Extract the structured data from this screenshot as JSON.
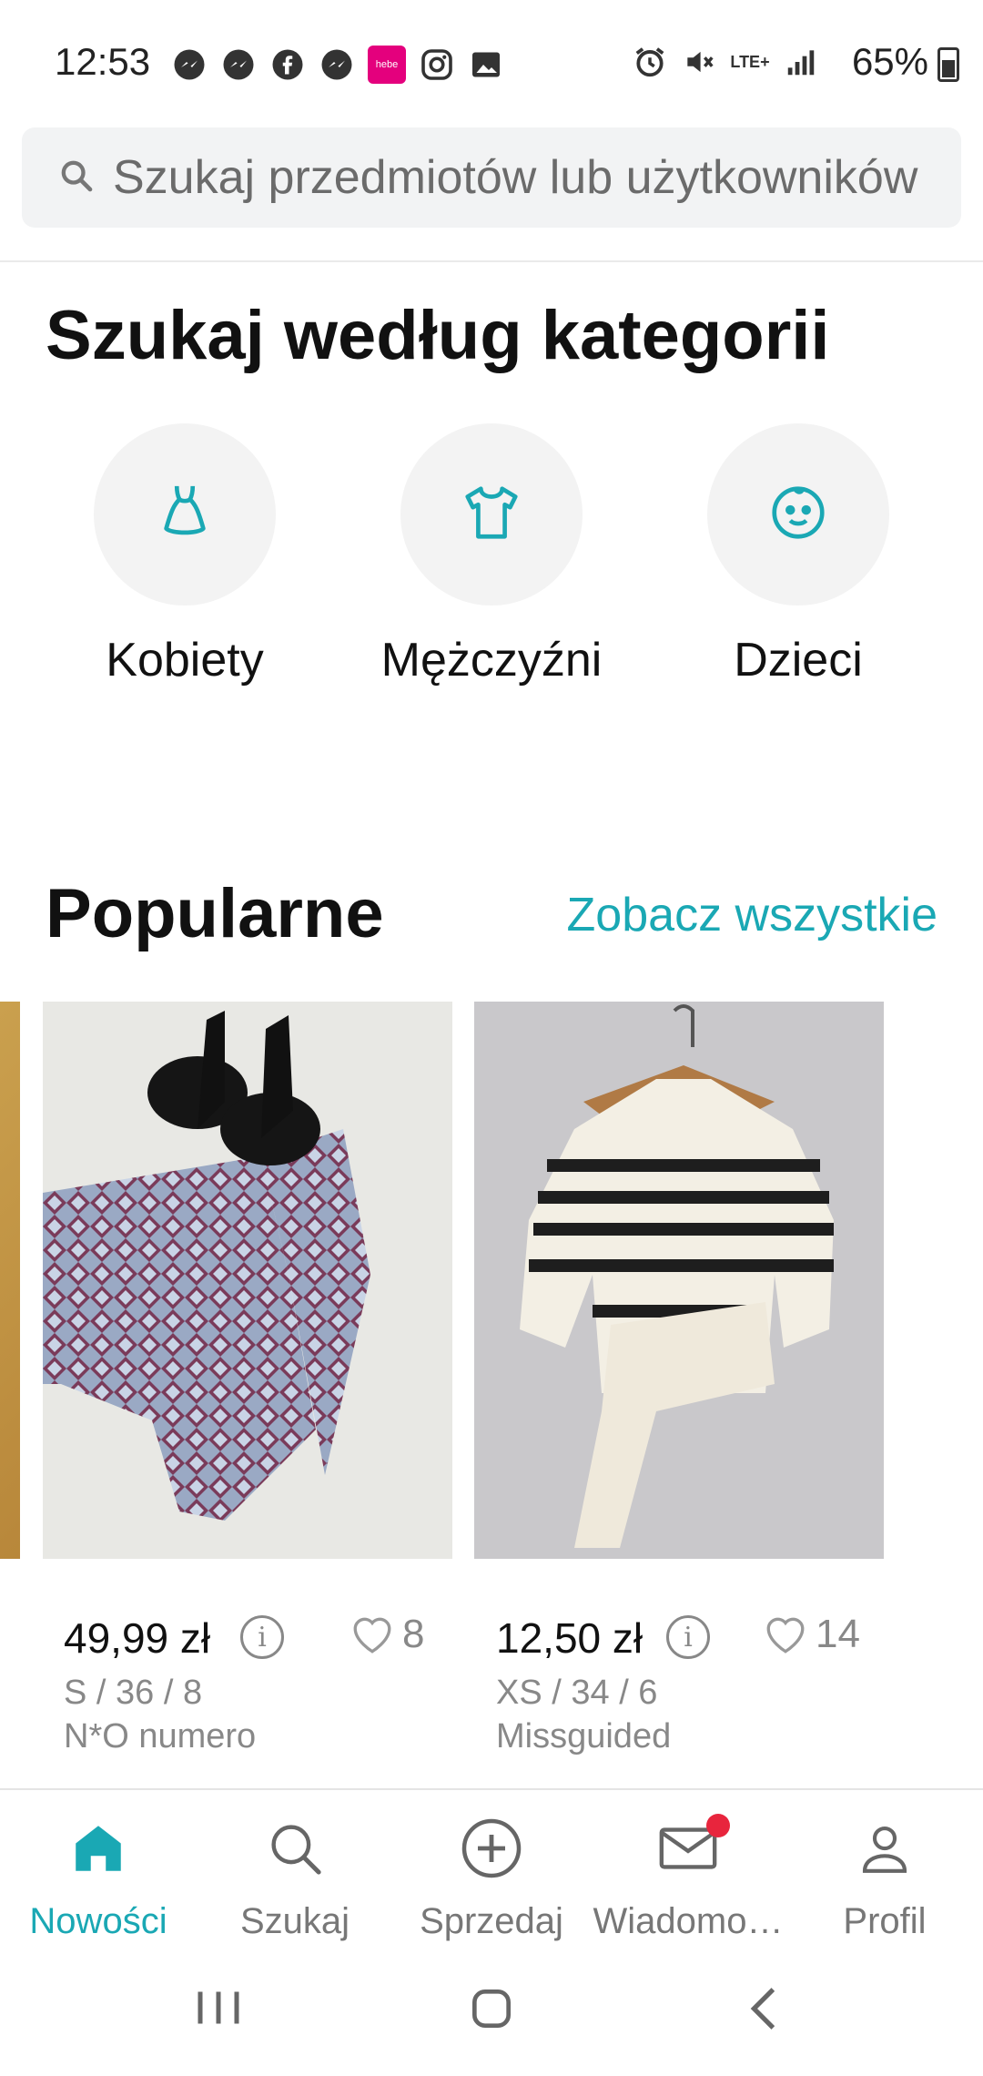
{
  "status_bar": {
    "time": "12:53",
    "battery": "65%",
    "network": "LTE+"
  },
  "search": {
    "placeholder": "Szukaj przedmiotów lub użytkowników"
  },
  "categories": {
    "title": "Szukaj według kategorii",
    "items": [
      {
        "label": "Kobiety",
        "icon": "dress-icon"
      },
      {
        "label": "Mężczyźni",
        "icon": "tshirt-icon"
      },
      {
        "label": "Dzieci",
        "icon": "baby-face-icon"
      }
    ]
  },
  "popular": {
    "title": "Popularne",
    "see_all": "Zobacz wszystkie",
    "items": [
      {
        "price": "49,99 zł",
        "likes": "8",
        "size": "S / 36 / 8",
        "brand": "N*O numero"
      },
      {
        "price": "12,50 zł",
        "likes": "14",
        "size": "XS / 34 / 6",
        "brand": "Missguided"
      }
    ]
  },
  "bottom_nav": [
    {
      "label": "Nowości",
      "icon": "home-icon",
      "active": true
    },
    {
      "label": "Szukaj",
      "icon": "search-icon"
    },
    {
      "label": "Sprzedaj",
      "icon": "plus-circle-icon"
    },
    {
      "label": "Wiadomo…",
      "icon": "mail-icon"
    },
    {
      "label": "Profil",
      "icon": "profile-icon"
    }
  ],
  "colors": {
    "accent": "#1aa8b4",
    "notification_dot": "#e8253d"
  }
}
